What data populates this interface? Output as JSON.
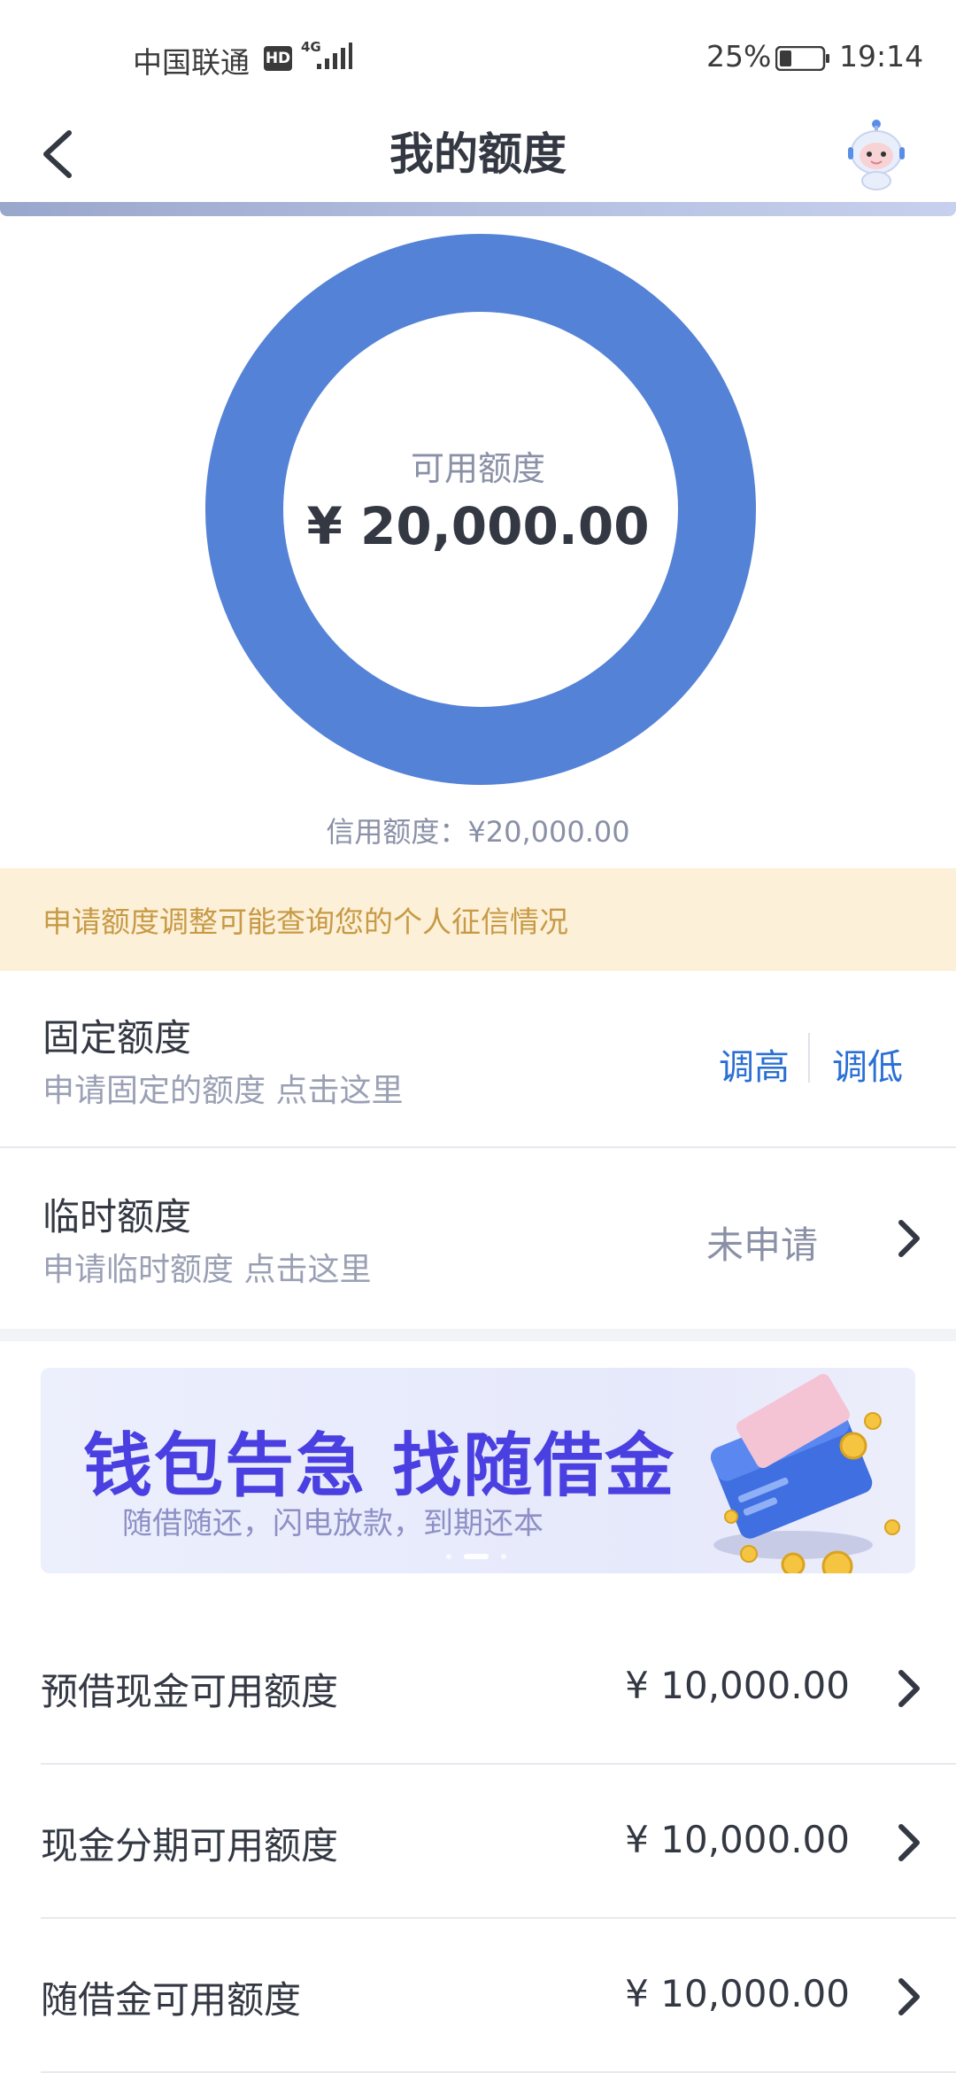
{
  "status_bar": {
    "carrier": "中国联通",
    "hd": "HD",
    "network": "4G",
    "battery": "25%",
    "time": "19:14"
  },
  "header": {
    "title": "我的额度"
  },
  "summary": {
    "available_label": "可用额度",
    "available_value": "¥ 20,000.00",
    "credit_line": "信用额度：¥20,000.00",
    "available_fraction": 1.0,
    "ring_color": "#5482d6"
  },
  "notice": {
    "text": "申请额度调整可能查询您的个人征信情况"
  },
  "fixed_limit": {
    "title": "固定额度",
    "subtitle": "申请固定的额度 点击这里",
    "raise_label": "调高",
    "lower_label": "调低"
  },
  "temp_limit": {
    "title": "临时额度",
    "subtitle": "申请临时额度 点击这里",
    "status": "未申请"
  },
  "banner": {
    "title": "钱包告急 找随借金",
    "subtitle": "随借随还，闪电放款，到期还本",
    "slide_count": 3,
    "active_slide": 2
  },
  "amounts": [
    {
      "label": "预借现金可用额度",
      "value": "¥ 10,000.00"
    },
    {
      "label": "现金分期可用额度",
      "value": "¥ 10,000.00"
    },
    {
      "label": "随借金可用额度",
      "value": "¥ 10,000.00"
    }
  ],
  "colors": {
    "accent": "#2a6fd4",
    "ring": "#5482d6",
    "notice_bg": "#fdf0d8",
    "notice_text": "#c79a45"
  }
}
